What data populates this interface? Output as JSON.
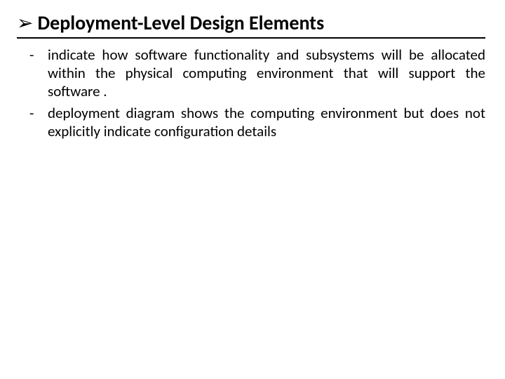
{
  "heading": {
    "bullet_glyph": "➢",
    "title": "Deployment-Level Design Elements"
  },
  "bullets": [
    {
      "marker": "-",
      "text": "indicate how software functionality and subsystems will be allocated within the physical computing environment that will support the software ."
    },
    {
      "marker": "-",
      "text": "deployment diagram shows the computing environment but does not explicitly indicate configuration details"
    }
  ]
}
